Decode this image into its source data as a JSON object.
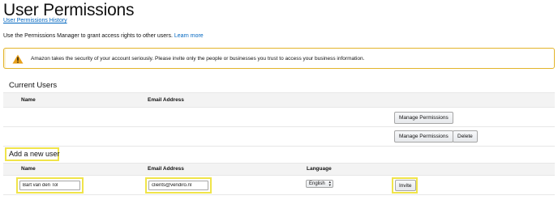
{
  "page": {
    "title": "User Permissions",
    "history_link": "User Permissions History",
    "intro_text": "Use the Permissions Manager to grant access rights to other users.",
    "learn_more": "Learn more"
  },
  "alert": {
    "icon": "warning-icon",
    "text": "Amazon takes the security of your account seriously. Please invite only the people or businesses you trust to access your business information.",
    "border_color": "#e3b42a"
  },
  "current_users": {
    "title": "Current Users",
    "columns": [
      "Name",
      "Email Address"
    ],
    "rows": [
      {
        "name": "",
        "email": "",
        "actions": [
          "Manage Permissions"
        ]
      },
      {
        "name": "",
        "email": "",
        "actions": [
          "Manage Permissions",
          "Delete"
        ]
      }
    ]
  },
  "add_user": {
    "title": "Add a new user",
    "columns": [
      "Name",
      "Email Address",
      "Language"
    ],
    "name_value": "Bart van den Tol",
    "email_value": "clients@vendiro.nl",
    "language_value": "English",
    "invite_label": "Invite",
    "highlight_color": "#f0e44a"
  }
}
